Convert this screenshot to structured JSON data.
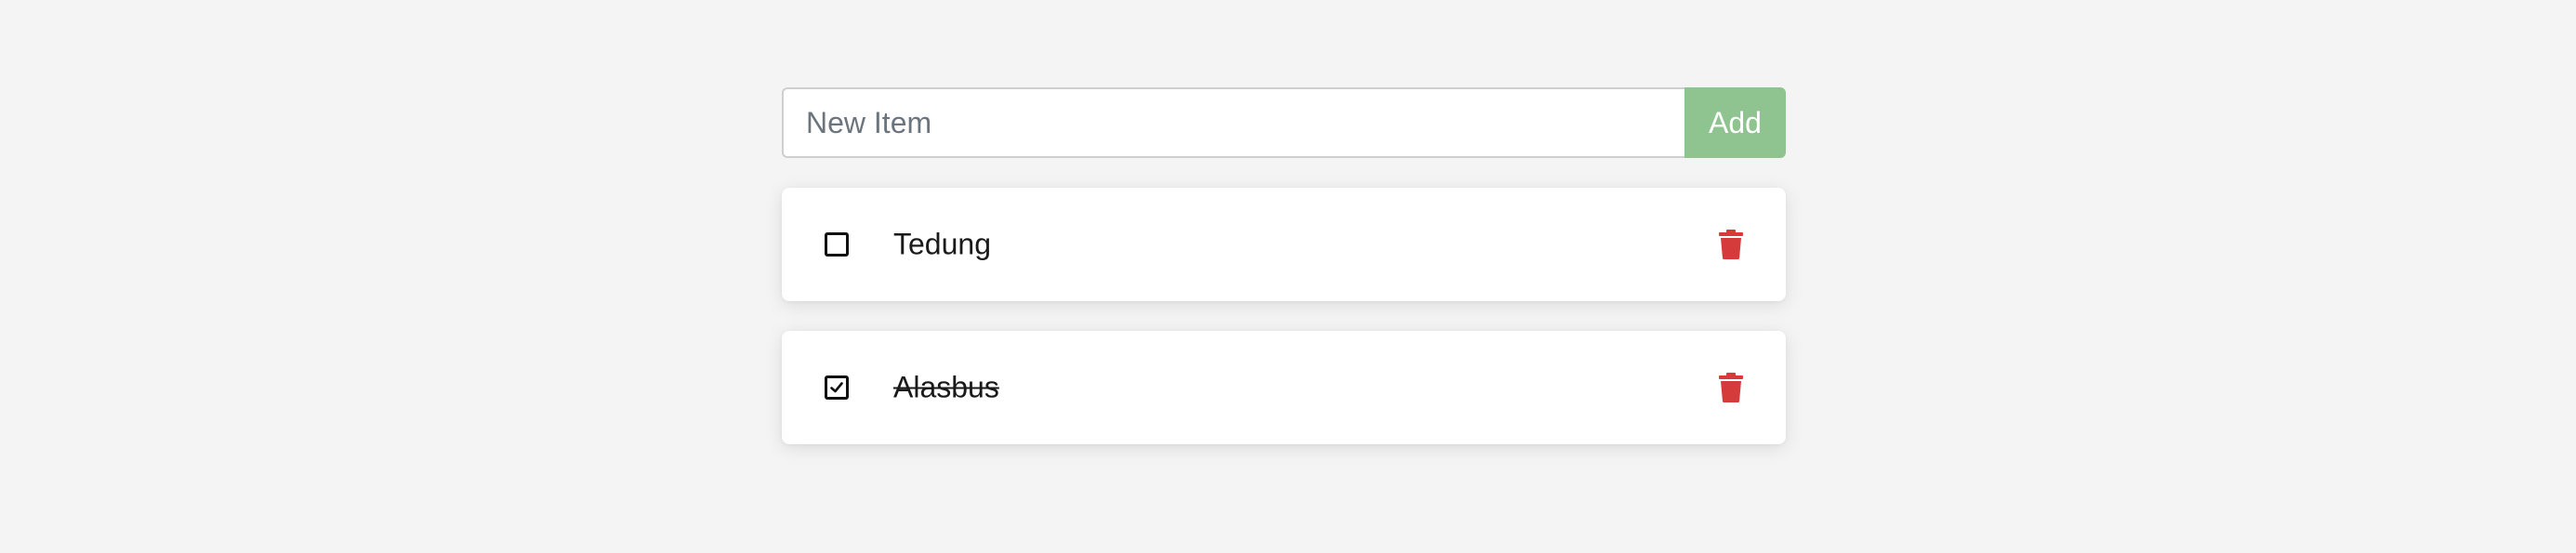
{
  "new_item": {
    "value": "",
    "placeholder": "New Item",
    "add_label": "Add"
  },
  "todos": [
    {
      "label": "Tedung",
      "completed": false
    },
    {
      "label": "Alasbus",
      "completed": true
    }
  ],
  "colors": {
    "background": "#f4f4f4",
    "add_button": "#8fc38f",
    "delete_icon": "#d63b3b"
  },
  "icons": {
    "delete": "trash-icon",
    "checked": "checkbox-checked-icon",
    "unchecked": "checkbox-unchecked-icon"
  }
}
